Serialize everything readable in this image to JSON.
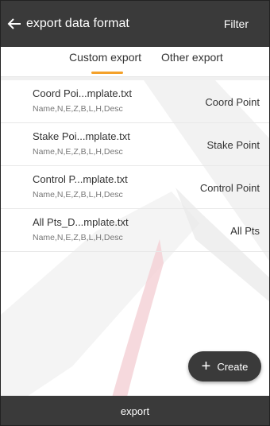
{
  "header": {
    "title": "export data format",
    "filter_label": "Filter"
  },
  "tabs": [
    {
      "label": "Custom export",
      "active": true
    },
    {
      "label": "Other export",
      "active": false
    }
  ],
  "templates": [
    {
      "file": "Coord Poi...mplate.txt",
      "fields": "Name,N,E,Z,B,L,H,Desc",
      "type": "Coord Point"
    },
    {
      "file": "Stake Poi...mplate.txt",
      "fields": "Name,N,E,Z,B,L,H,Desc",
      "type": "Stake Point"
    },
    {
      "file": "Control P...mplate.txt",
      "fields": "Name,N,E,Z,B,L,H,Desc",
      "type": "Control Point"
    },
    {
      "file": "All Pts_D...mplate.txt",
      "fields": "Name,N,E,Z,B,L,H,Desc",
      "type": "All Pts"
    }
  ],
  "create_button": {
    "label": "Create",
    "icon": "plus-icon"
  },
  "footer": {
    "export_label": "export"
  },
  "colors": {
    "bar": "#3a3a3a",
    "accent": "#f4a12a"
  }
}
